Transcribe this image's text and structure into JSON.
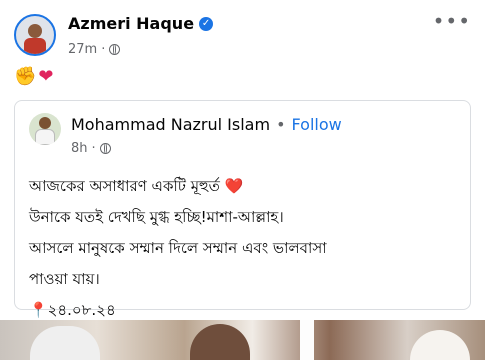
{
  "post": {
    "author": "Azmeri Haque",
    "time": "27m",
    "reactions": [
      "fist-bump-emoji",
      "heart-emoji"
    ]
  },
  "shared": {
    "author": "Mohammad Nazrul Islam",
    "separator": "•",
    "follow_label": "Follow",
    "time": "8h",
    "lines": [
      "আজকের অসাধারণ একটি মূহুর্ত ❤️",
      "উনাকে যতই দেখছি মুগ্ধ হচ্ছি!মাশা-আল্লাহ।",
      "আসলে মানুষকে সম্মান দিলে সম্মান এবং ভালবাসা",
      "পাওয়া যায়।",
      "📍২৪.০৮.২৪"
    ]
  },
  "colors": {
    "accent": "#1b74e4",
    "muted": "#65676b"
  }
}
